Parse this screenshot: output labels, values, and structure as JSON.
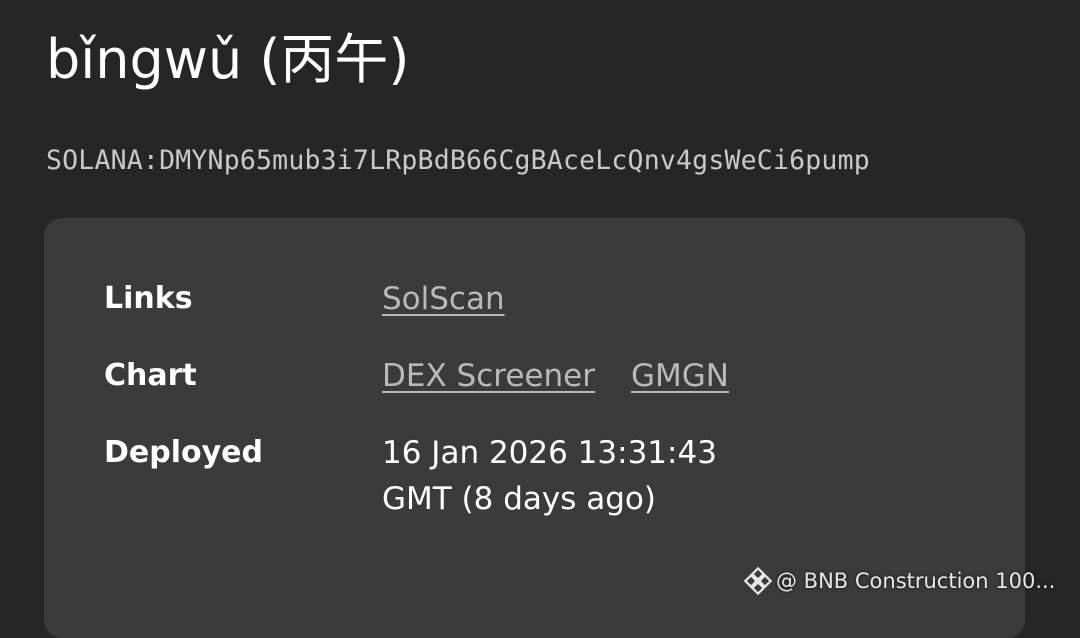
{
  "token": {
    "title": "bǐngwǔ (丙午)",
    "address": "SOLANA:DMYNp65mub3i7LRpBdB66CgBAceLcQnv4gsWeCi6pump"
  },
  "details": {
    "links": {
      "label": "Links",
      "items": [
        "SolScan"
      ]
    },
    "chart": {
      "label": "Chart",
      "items": [
        "DEX Screener",
        "GMGN"
      ]
    },
    "deployed": {
      "label": "Deployed",
      "value": "16 Jan 2026 13:31:43 GMT (8 days ago)"
    }
  },
  "watermark": {
    "icon": "binance-diamond-icon",
    "text": "@ BNB Construction 100..."
  },
  "colors": {
    "background": "#262626",
    "card": "#3b3b3b",
    "link": "#b9b9b9",
    "address": "#c9c9c9"
  }
}
